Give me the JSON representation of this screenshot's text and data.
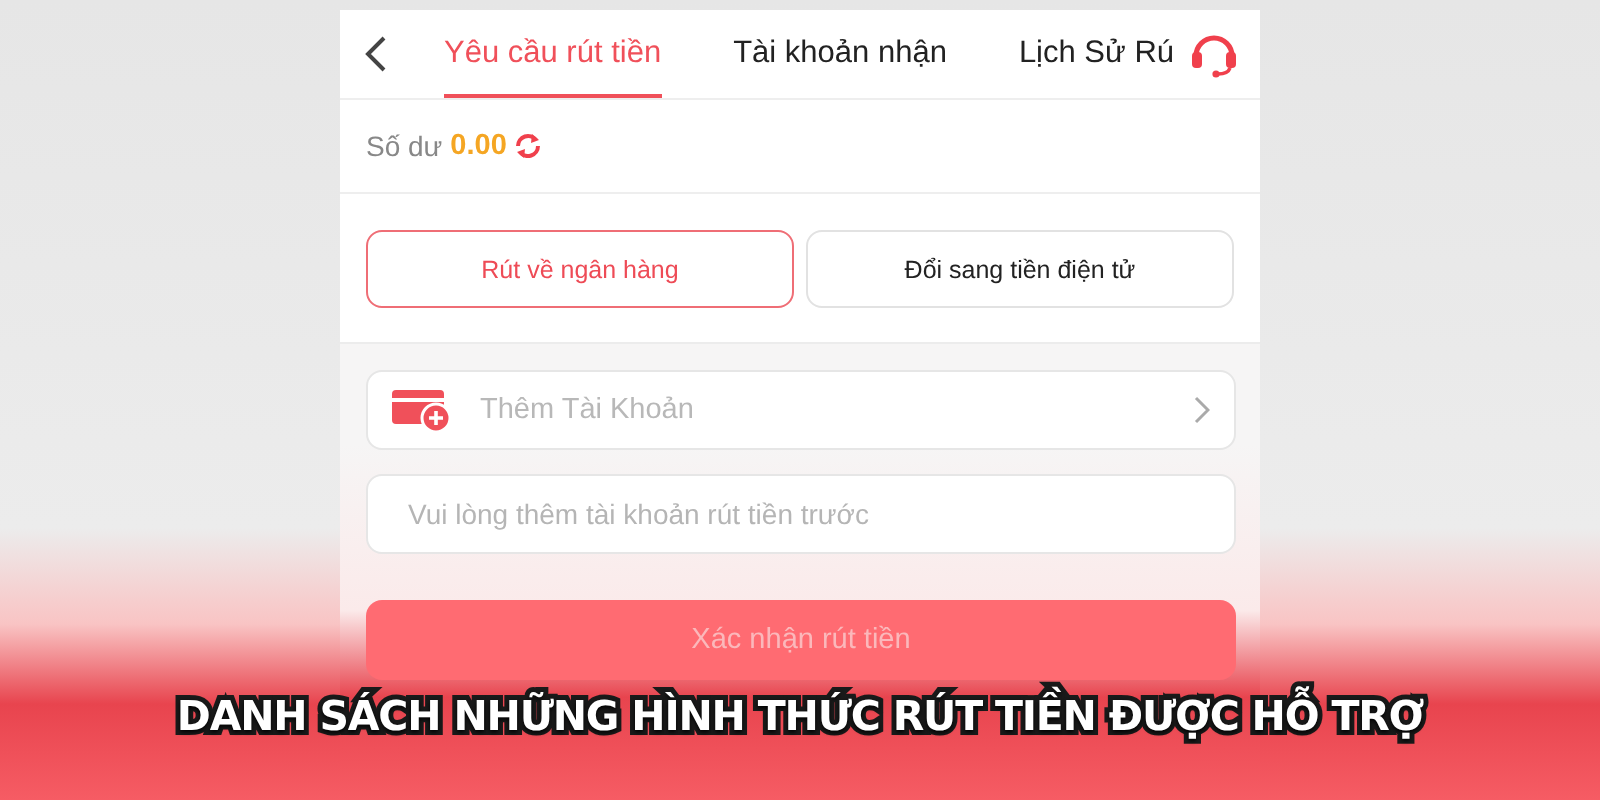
{
  "header": {
    "tabs": [
      {
        "label": "Yêu cầu rút tiền",
        "selected": true
      },
      {
        "label": "Tài khoản nhận",
        "selected": false
      },
      {
        "label": "Lịch Sử Rú",
        "selected": false
      }
    ]
  },
  "balance": {
    "label": "Số dư",
    "amount": "0.00"
  },
  "methods": [
    {
      "label": "Rút về ngân hàng",
      "selected": true
    },
    {
      "label": "Đổi sang tiền điện tử",
      "selected": false
    }
  ],
  "account_row": {
    "label": "Thêm Tài Khoản"
  },
  "notice_field": {
    "placeholder": "Vui lòng thêm tài khoản rút tiền trước"
  },
  "confirm_button": {
    "label": "Xác nhận rút tiền",
    "disabled": true
  },
  "caption": "DANH SÁCH NHỮNG HÌNH THỨC RÚT TIỀN ĐƯỢC HỖ TRỢ"
}
